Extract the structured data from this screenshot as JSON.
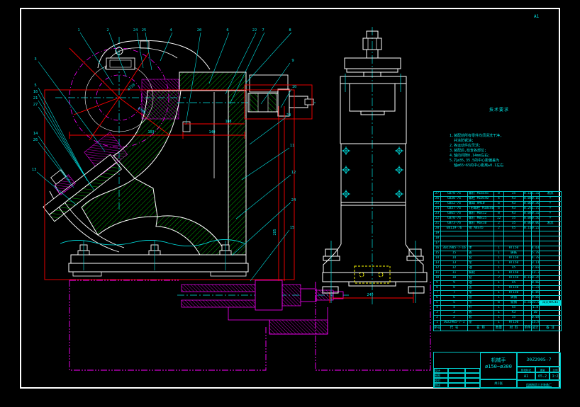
{
  "meta": {
    "corner_mark": "A1"
  },
  "notes": {
    "title": "技术要求",
    "lines": [
      "1.装配前所有零件均须清洗干净,",
      "  并涂防锈油;",
      "2.各运动件应灵活;",
      "3.装配后,检查各部位;",
      "4.轴向间隙0.14mm左右;",
      "5.孔ø35,35.5的中心距偏差为",
      "  轴ø65~65的中心距离±0.1左右"
    ]
  },
  "balloons": {
    "b1": "1",
    "b2": "2",
    "b24a": "24",
    "b25": "25",
    "b4": "4",
    "b20": "20",
    "b6": "6",
    "b22": "22",
    "b7": "7",
    "b8": "8",
    "b9": "9",
    "b10": "10",
    "b23": "23",
    "b11": "11",
    "b12": "12",
    "b24b": "24",
    "b15": "15",
    "b3": "3",
    "b5": "5",
    "b16": "16",
    "b21": "21",
    "b27": "27",
    "b14": "14",
    "b26": "26",
    "b13": "13"
  },
  "dims": {
    "d150": "ø150",
    "d300": "ø300",
    "d103": "103",
    "d140": "140",
    "d108": "108",
    "d240": "240",
    "d285": "285"
  },
  "bom": {
    "headers": [
      "序号",
      "代 号",
      "名 称",
      "数量",
      "材 料",
      "单件",
      "总计",
      "备 注"
    ],
    "rows": [
      {
        "no": "27",
        "code": "GB70-76",
        "name": "螺钉 M16x45",
        "qty": "8",
        "mtl": "35",
        "w1": "0.11",
        "w2": "1.32",
        "rem": "发黑",
        "cls": ""
      },
      {
        "no": "26",
        "code": "GB30-76",
        "name": "螺栓 M10x40",
        "qty": "4",
        "mtl": "A3",
        "w1": "0.04",
        "w2": "0.16",
        "rem": "〃",
        "cls": ""
      },
      {
        "no": "25",
        "code": "GB52-76",
        "name": "螺母 AM10",
        "qty": "6",
        "mtl": "A3",
        "w1": "0.06",
        "w2": "0.36",
        "rem": "〃",
        "cls": ""
      },
      {
        "no": "24",
        "code": "GB37-76",
        "name": "T形螺栓 M10x40",
        "qty": "6",
        "mtl": "A3",
        "w1": "0.29",
        "w2": "1.75",
        "rem": "〃",
        "cls": ""
      },
      {
        "no": "23",
        "code": "GB65-76",
        "name": "螺钉 M6x12",
        "qty": "8",
        "mtl": "A3",
        "w1": "0.04",
        "w2": "0.32",
        "rem": "〃",
        "cls": ""
      },
      {
        "no": "22",
        "code": "GB70-76",
        "name": "螺钉 M8x25",
        "qty": "12",
        "mtl": "35",
        "w1": "0.042",
        "w2": "0.504",
        "rem": "〃",
        "cls": ""
      },
      {
        "no": "21",
        "code": "GB73-76",
        "name": "螺钉 M6x10",
        "qty": "2",
        "mtl": "35",
        "w1": "0.003",
        "w2": "0.006",
        "rem": "发黑",
        "cls": ""
      },
      {
        "no": "20",
        "code": "GB119-76",
        "name": "销 A8x45",
        "qty": "2",
        "mtl": "45",
        "w1": "0.11",
        "w2": "0.22",
        "rem": "",
        "cls": ""
      },
      {
        "no": "19",
        "code": "",
        "name": "",
        "qty": "",
        "mtl": "",
        "w1": "",
        "w2": "",
        "rem": "",
        "cls": ""
      },
      {
        "no": "18",
        "code": "",
        "name": "",
        "qty": "",
        "mtl": "",
        "w1": "",
        "w2": "",
        "rem": "",
        "cls": ""
      },
      {
        "no": "17",
        "code": "",
        "name": "",
        "qty": "",
        "mtl": "",
        "w1": "",
        "w2": "",
        "rem": "",
        "cls": ""
      },
      {
        "no": "16",
        "code": "30Z2905-7-16",
        "name": "体",
        "qty": "1",
        "mtl": "HT150",
        "w1": "",
        "w2": "4.61",
        "rem": "",
        "cls": ""
      },
      {
        "no": "15",
        "code": "15",
        "name": "盖",
        "qty": "1",
        "mtl": "铸铁",
        "w1": "",
        "w2": "5.781",
        "rem": "",
        "cls": ""
      },
      {
        "no": "14",
        "code": "14",
        "name": "套",
        "qty": "1",
        "mtl": "HT150",
        "w1": "",
        "w2": "4.786",
        "rem": "",
        "cls": ""
      },
      {
        "no": "13",
        "code": "13",
        "name": "架",
        "qty": "1",
        "mtl": "HT150",
        "w1": "",
        "w2": "3.11",
        "rem": "",
        "cls": ""
      },
      {
        "no": "12",
        "code": "12",
        "name": "轴",
        "qty": "1",
        "mtl": "45",
        "w1": "",
        "w2": "2.07",
        "rem": "",
        "cls": ""
      },
      {
        "no": "11",
        "code": "11",
        "name": "蜗轮",
        "qty": "1",
        "mtl": "HT150",
        "w1": "",
        "w2": "12.3",
        "rem": "",
        "cls": ""
      },
      {
        "no": "10",
        "code": "10",
        "name": "套",
        "qty": "2",
        "mtl": "HT150",
        "w1": "0.175",
        "w2": "0.35",
        "rem": "",
        "cls": ""
      },
      {
        "no": "9",
        "code": "9",
        "name": "轴",
        "qty": "1",
        "mtl": "45",
        "w1": "",
        "w2": "0.604",
        "rem": "",
        "cls": ""
      },
      {
        "no": "8",
        "code": "8",
        "name": "盖",
        "qty": "1",
        "mtl": "HT150",
        "w1": "",
        "w2": "1.37",
        "rem": "",
        "cls": ""
      },
      {
        "no": "7",
        "code": "7",
        "name": "架",
        "qty": "1",
        "mtl": "HT150",
        "w1": "",
        "w2": "4.85",
        "rem": "",
        "cls": ""
      },
      {
        "no": "6",
        "code": "6",
        "name": "盘",
        "qty": "1",
        "mtl": "铸钢",
        "w1": "",
        "w2": "9.695",
        "rem": "",
        "cls": ""
      },
      {
        "no": "5",
        "code": "5",
        "name": "爪",
        "qty": "6",
        "mtl": "锻钢",
        "w1": "5.51",
        "w2": "33.06",
        "rem": "淬火HRC45",
        "cls": "hl"
      },
      {
        "no": "4",
        "code": "4",
        "name": "杆",
        "qty": "1",
        "mtl": "45",
        "w1": "",
        "w2": "1.8",
        "rem": "",
        "cls": ""
      },
      {
        "no": "3",
        "code": "3",
        "name": "板",
        "qty": "1",
        "mtl": "A3",
        "w1": "",
        "w2": "10",
        "rem": "",
        "cls": ""
      },
      {
        "no": "2",
        "code": "2",
        "name": "套",
        "qty": "1",
        "mtl": "35",
        "w1": "",
        "w2": "0.048",
        "rem": "",
        "cls": ""
      },
      {
        "no": "1",
        "code": "30Z2905-7-1",
        "name": "座",
        "qty": "1",
        "mtl": "HT150",
        "w1": "",
        "w2": "15.81",
        "rem": "",
        "cls": ""
      }
    ]
  },
  "title_block": {
    "product_name": "机械手",
    "spec": "ø150~ø300",
    "drawing_no": "30Z2905-7",
    "left_rows": [
      {
        "label": "设计",
        "name": "",
        "date": ""
      },
      {
        "label": "制图",
        "name": "",
        "date": ""
      },
      {
        "label": "校对",
        "name": "",
        "date": ""
      },
      {
        "label": "审核",
        "name": "",
        "date": ""
      }
    ],
    "stage_label": "阶段标记",
    "weight_label": "重量",
    "scale_label": "比例",
    "stage": "A1",
    "weight": "65.2",
    "scale": "1:2",
    "sheet": "共1张",
    "company": "机械制造工艺装备厂"
  }
}
